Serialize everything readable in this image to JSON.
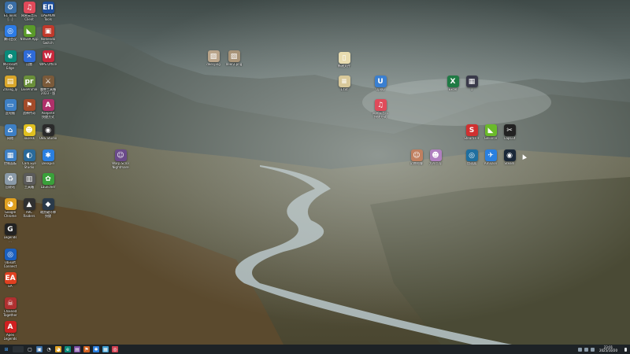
{
  "desktop_icons": [
    {
      "label": "EL Tools\n[...]",
      "bg": "#3a6ea5",
      "glyph": "⚙",
      "icon": "app-icon"
    },
    {
      "label": "网易云音乐\nClient",
      "bg": "#e04a5a",
      "glyph": "♫",
      "icon": "music-icon"
    },
    {
      "label": "DAEMON\nTools",
      "bg": "#1f4f99",
      "glyph": "EΠ",
      "icon": "disc-icon"
    },
    {
      "label": "腾讯会议",
      "bg": "#2c7be5",
      "glyph": "◎",
      "icon": "meeting-icon"
    },
    {
      "label": "NVIDIA App",
      "bg": "#5a9a2a",
      "glyph": "◣",
      "icon": "nvidia-icon"
    },
    {
      "label": "Nintendo\nSwitch",
      "bg": "#c0392b",
      "glyph": "▣",
      "icon": "switch-icon"
    },
    {
      "label": "Microsoft\nEdge",
      "bg": "#0a8a7a",
      "glyph": "e",
      "icon": "edge-icon"
    },
    {
      "label": "迅雷",
      "bg": "#2f6bd6",
      "glyph": "✕",
      "icon": "thunder-icon"
    },
    {
      "label": "WPS Office",
      "bg": "#c8283c",
      "glyph": "W",
      "icon": "wps-icon"
    },
    {
      "label": "Zhang_ly",
      "bg": "#d8a62a",
      "glyph": "▤",
      "icon": "folder-icon"
    },
    {
      "label": "LiveProfile",
      "bg": "#6a8f3a",
      "glyph": "pr",
      "icon": "profile-icon"
    },
    {
      "label": "魔兽工具箱\n2023 - 版",
      "bg": "#7a5a3a",
      "glyph": "⚔",
      "icon": "game-icon"
    },
    {
      "label": "此电脑",
      "bg": "#3d7fc4",
      "glyph": "▭",
      "icon": "computer-icon"
    },
    {
      "label": "战神传奇",
      "bg": "#a34b2a",
      "glyph": "⚑",
      "icon": "game-icon"
    },
    {
      "label": "Aseprite\n快捷方式",
      "bg": "#b0306a",
      "glyph": "A",
      "icon": "aseprite-icon"
    },
    {
      "label": "网络",
      "bg": "#3d7fc4",
      "glyph": "⌂",
      "icon": "network-icon"
    },
    {
      "label": "ToDesk",
      "bg": "#e0c020",
      "glyph": "☻",
      "icon": "todesk-icon"
    },
    {
      "label": "OBS Studio",
      "bg": "#2a2a2a",
      "glyph": "◉",
      "icon": "obs-icon"
    },
    {
      "label": "控制面板",
      "bg": "#3d7fc4",
      "glyph": "▦",
      "icon": "control-panel-icon"
    },
    {
      "label": "Cam Eye\nStudio",
      "bg": "#2a6a9a",
      "glyph": "◐",
      "icon": "camera-icon"
    },
    {
      "label": "Deskpin",
      "bg": "#2a7fe0",
      "glyph": "✱",
      "icon": "pin-icon"
    },
    {
      "label": "回收站",
      "bg": "#8a9aa8",
      "glyph": "♻",
      "icon": "recycle-bin-icon"
    },
    {
      "label": "工具箱",
      "bg": "#5a5a5a",
      "glyph": "▥",
      "icon": "toolbox-icon"
    },
    {
      "label": "Launcher",
      "bg": "#3aa03a",
      "glyph": "✿",
      "icon": "launcher-icon"
    },
    {
      "label": "Google\nChrome",
      "bg": "#e0a020",
      "glyph": "◕",
      "icon": "chrome-icon"
    },
    {
      "label": "ARC\nRaiders",
      "bg": "#303030",
      "glyph": "▲",
      "icon": "game-icon"
    },
    {
      "label": "暗黑破坏神\n快捷",
      "bg": "#2a3a4a",
      "glyph": "◆",
      "icon": "game-icon"
    },
    {
      "label": "Legends\n...",
      "bg": "#222",
      "glyph": "G",
      "icon": "game-icon"
    },
    {
      "label": "Ubisoft\nConnect",
      "bg": "#1a5fbf",
      "glyph": "◎",
      "icon": "ubisoft-icon"
    },
    {
      "label": "EA",
      "bg": "#e04020",
      "glyph": "EA",
      "icon": "ea-icon"
    },
    {
      "label": "Chained\nTogether",
      "bg": "#b03030",
      "glyph": "☠",
      "icon": "game-icon"
    },
    {
      "label": "Apex\nLegends",
      "bg": "#d02020",
      "glyph": "A",
      "icon": "apex-icon"
    },
    {
      "label": "Warp Scrol\nNightmare",
      "bg": "#6a4a8a",
      "glyph": "☺",
      "icon": "game-icon"
    },
    {
      "label": "deer.png",
      "bg": "#b9a48a",
      "glyph": "▨",
      "icon": "image-icon"
    },
    {
      "label": "deer2.png",
      "bg": "#a89478",
      "glyph": "▨",
      "icon": "image-icon"
    },
    {
      "label": "新建文件",
      "bg": "#e8dcb0",
      "glyph": "▯",
      "icon": "file-icon"
    },
    {
      "label": "1.txt",
      "bg": "#d8c89a",
      "glyph": "≡",
      "icon": "text-file-icon"
    },
    {
      "label": "Uplay",
      "bg": "#3a7fd0",
      "glyph": "U",
      "icon": "uplay-icon"
    },
    {
      "label": "网易云音乐\n快捷方式",
      "bg": "#e04a5a",
      "glyph": "♫",
      "icon": "music-icon"
    },
    {
      "label": "Excel",
      "bg": "#1f7a44",
      "glyph": "X",
      "icon": "excel-icon"
    },
    {
      "label": "1",
      "bg": "#3a3a4a",
      "glyph": "▦",
      "icon": "image-icon"
    },
    {
      "label": "Steam++",
      "bg": "#d03030",
      "glyph": "S",
      "icon": "app-icon"
    },
    {
      "label": "GeForce",
      "bg": "#6aba2a",
      "glyph": "◣",
      "icon": "geforce-icon"
    },
    {
      "label": "CapCut",
      "bg": "#222",
      "glyph": "✂",
      "icon": "capcut-icon"
    },
    {
      "label": "幻兽帕鲁",
      "bg": "#c08060",
      "glyph": "☺",
      "icon": "game-icon"
    },
    {
      "label": "方舟生存",
      "bg": "#b080c0",
      "glyph": "☻",
      "icon": "game-icon"
    },
    {
      "label": "加速器",
      "bg": "#1f6fa0",
      "glyph": "◎",
      "icon": "app-icon"
    },
    {
      "label": "Amazon",
      "bg": "#2a80e0",
      "glyph": "✈",
      "icon": "app-icon"
    },
    {
      "label": "Steam",
      "bg": "#1b2838",
      "glyph": "◉",
      "icon": "steam-icon"
    }
  ],
  "taskbar": {
    "start_glyph": "⊞",
    "apps": [
      {
        "glyph": "▢",
        "bg": "#1d2226"
      },
      {
        "glyph": "▣",
        "bg": "#3a6ea5"
      },
      {
        "glyph": "◔",
        "bg": "#1d2226"
      },
      {
        "glyph": "◕",
        "bg": "#e0a020"
      },
      {
        "glyph": "e",
        "bg": "#0a8a7a"
      },
      {
        "glyph": "▤",
        "bg": "#7a4aa0"
      },
      {
        "glyph": "⚑",
        "bg": "#d06020"
      },
      {
        "glyph": "✱",
        "bg": "#2a7fe0"
      },
      {
        "glyph": "▦",
        "bg": "#3a9ad0"
      },
      {
        "glyph": "◎",
        "bg": "#d04050"
      }
    ]
  },
  "clock": {
    "time": "23:01",
    "date": "2025/10/20"
  },
  "colors": {
    "taskbar": "#1d2226",
    "accent": "#3a6ea5"
  }
}
